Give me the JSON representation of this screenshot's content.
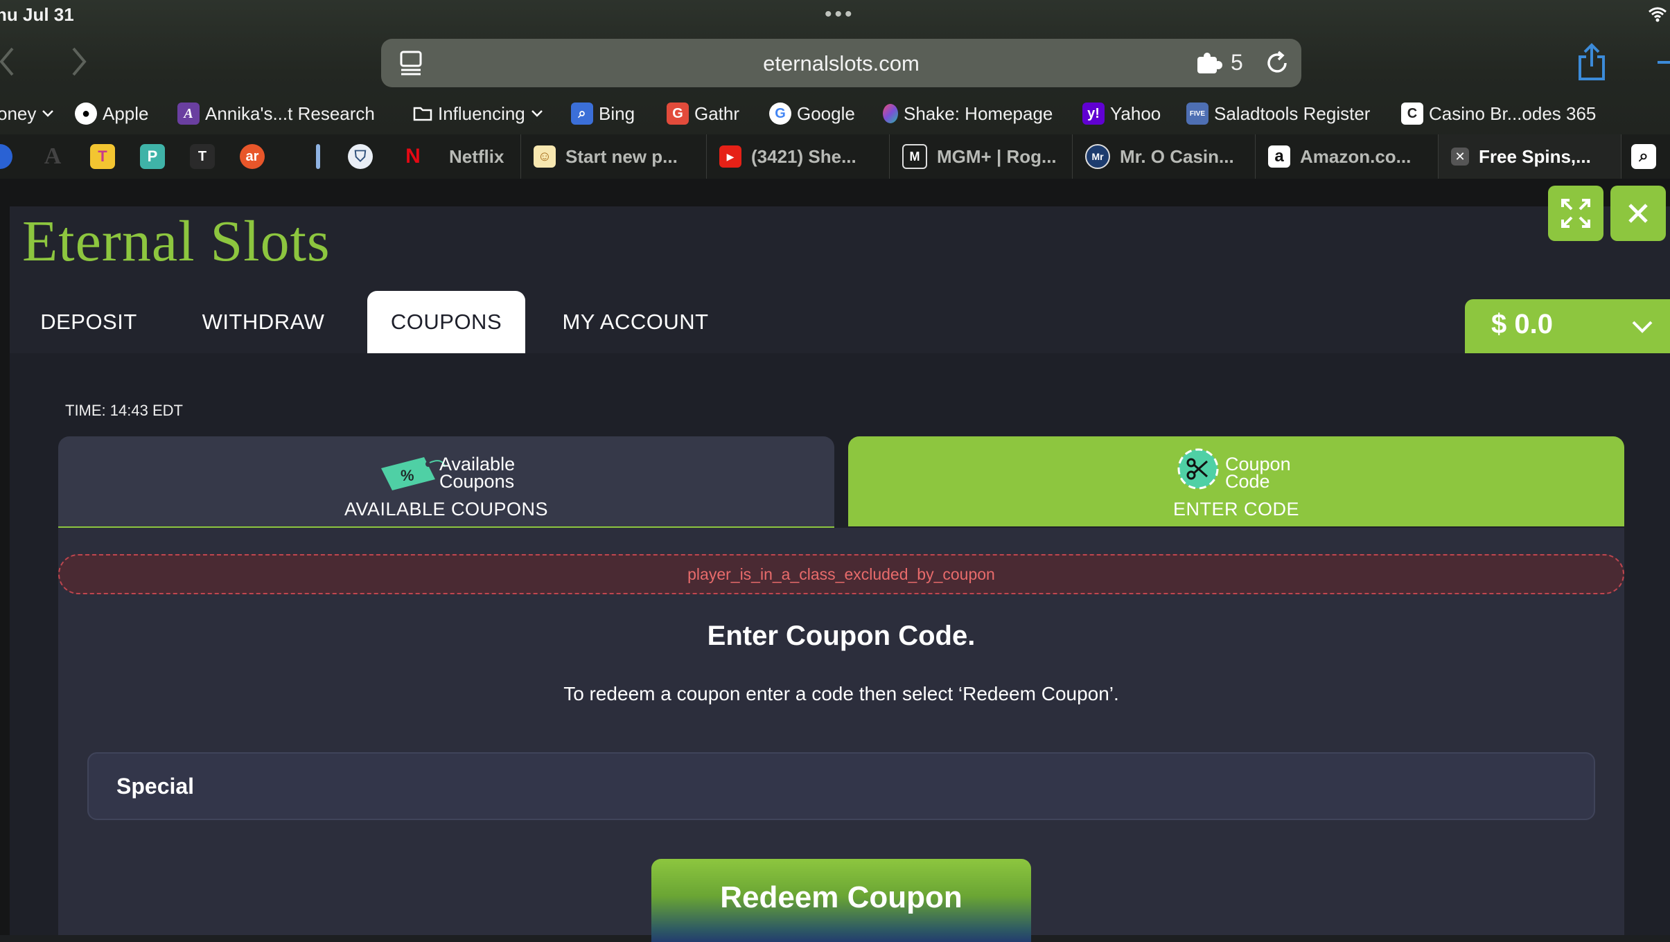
{
  "status_bar": {
    "time": "hu Jul 31",
    "dots": "•••"
  },
  "browser": {
    "url": "eternalslots.com",
    "extension_count": "5",
    "bookmarks": [
      {
        "label": "oney",
        "icon": "dropdown-chevron-icon"
      },
      {
        "label": "Apple",
        "icon": "apple-icon"
      },
      {
        "label": "Annika's...t Research",
        "icon": "annika-icon"
      },
      {
        "label": "Influencing",
        "icon": "folder-icon"
      },
      {
        "label": "Bing",
        "icon": "bing-icon"
      },
      {
        "label": "Gathr",
        "icon": "gathr-icon"
      },
      {
        "label": "Google",
        "icon": "google-icon"
      },
      {
        "label": "Shake: Homepage",
        "icon": "shake-icon"
      },
      {
        "label": "Yahoo",
        "icon": "yahoo-icon"
      },
      {
        "label": "Saladtools Register",
        "icon": "saladtools-icon"
      },
      {
        "label": "Casino Br...odes 365",
        "icon": "casino-icon"
      }
    ],
    "tabs": [
      {
        "label": "Netflix"
      },
      {
        "label": "Start new p..."
      },
      {
        "label": "(3421) She..."
      },
      {
        "label": "MGM+ | Rog..."
      },
      {
        "label": "Mr. O Casin..."
      },
      {
        "label": "Amazon.co..."
      },
      {
        "label": "Free Spins,..."
      }
    ],
    "pinned_letters": {
      "a": "A",
      "t1": "T",
      "p": "P",
      "t2": "T",
      "ar": "ar",
      "n": "N",
      "m": "M",
      "mr": "Mr",
      "amz": "a"
    }
  },
  "site": {
    "brand": "Eternal Slots",
    "nav": {
      "deposit": "DEPOSIT",
      "withdraw": "WITHDRAW",
      "coupons": "COUPONS",
      "my_account": "MY ACCOUNT"
    },
    "balance": "$ 0.0",
    "time_label": "TIME: 14:43 EDT",
    "coupon_tabs": {
      "available": {
        "icon_text_1": "Available",
        "icon_text_2": "Coupons",
        "caption": "AVAILABLE COUPONS",
        "percent": "%"
      },
      "code": {
        "icon_text_1": "Coupon",
        "icon_text_2": "Code",
        "caption": "ENTER CODE"
      }
    },
    "error": "player_is_in_a_class_excluded_by_coupon",
    "heading": "Enter Coupon Code.",
    "description": "To redeem a coupon enter a code then select ‘Redeem Coupon’.",
    "code_input_value": "Special",
    "redeem_button": "Redeem Coupon"
  },
  "colors": {
    "accent_green": "#8dc63f",
    "panel": "#22242d",
    "error_text": "#e86b6b"
  }
}
